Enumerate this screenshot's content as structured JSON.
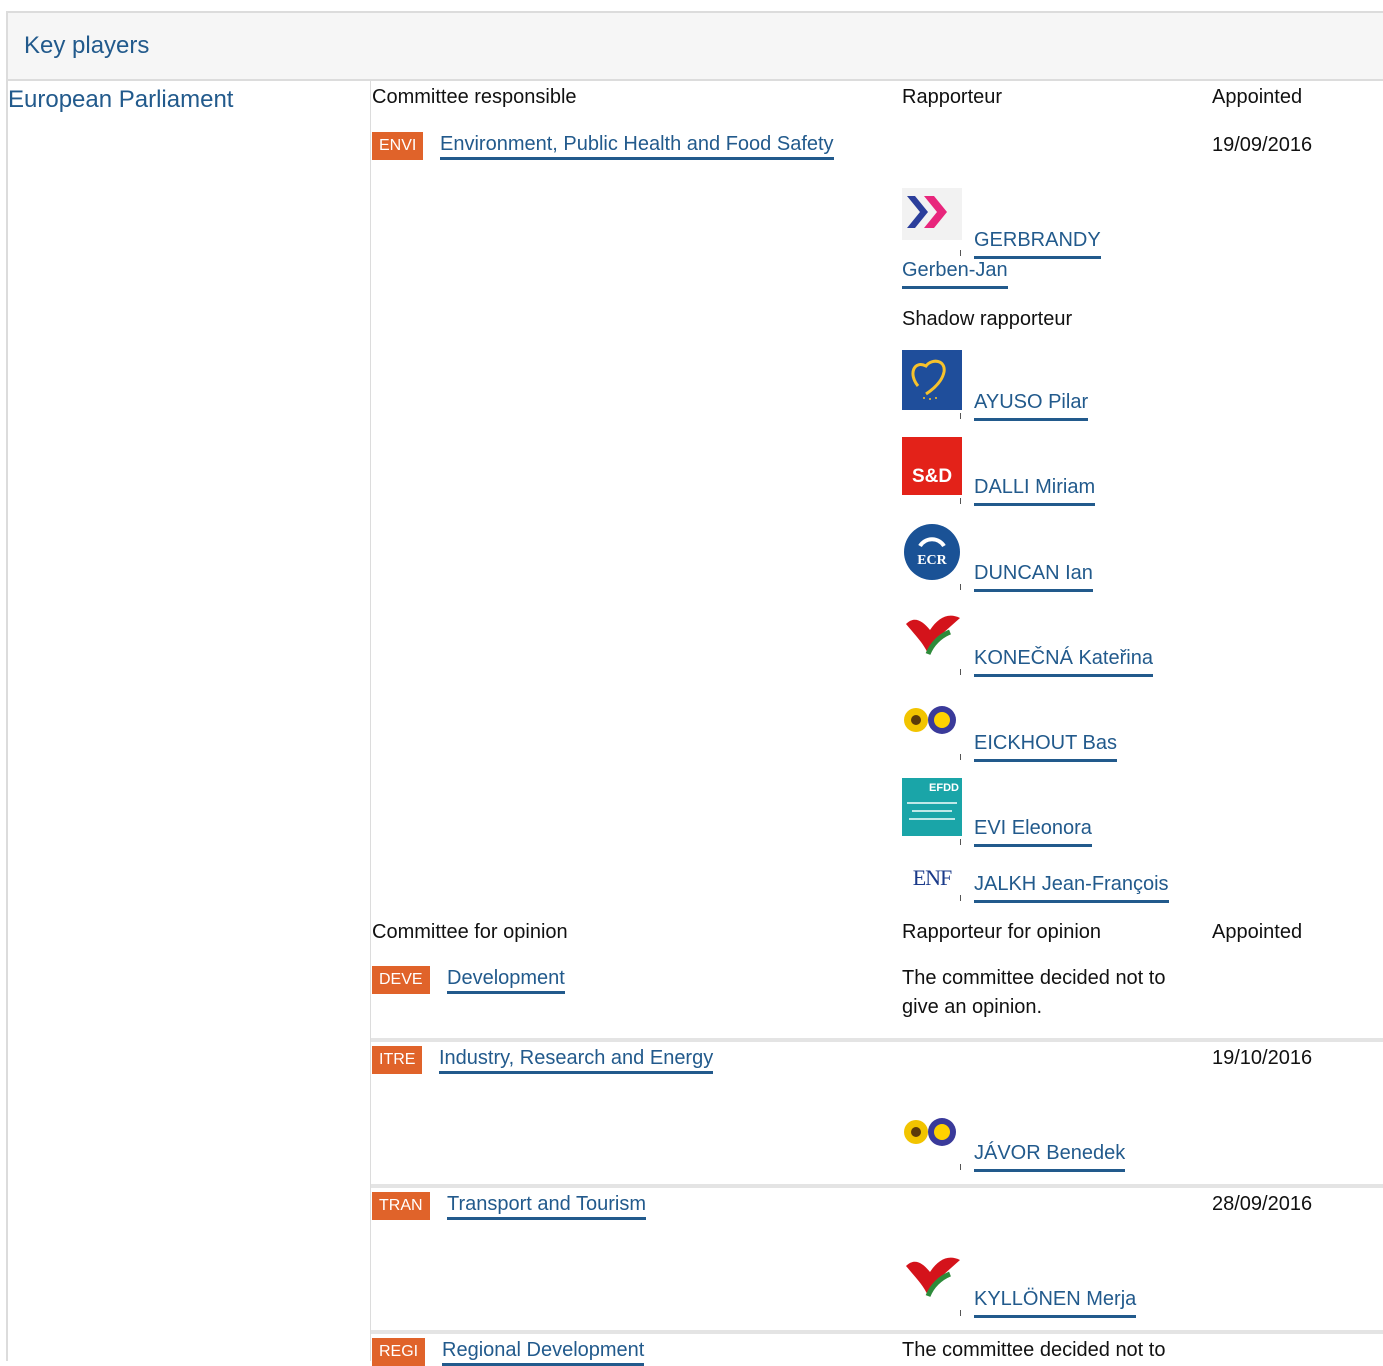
{
  "page_title": "Key players",
  "institution": "European Parliament",
  "committee_responsible": {
    "headers": {
      "committee": "Committee responsible",
      "rapporteur": "Rapporteur",
      "appointed": "Appointed"
    },
    "committee": {
      "code": "ENVI",
      "name": "Environment, Public Health and Food Safety",
      "appointed": "19/09/2016"
    },
    "rapporteur": {
      "name_line1": "GERBRANDY",
      "name_line2": "Gerben-Jan",
      "group_logo": "alde-chevron-logo"
    },
    "shadow_label": "Shadow rapporteur",
    "shadow_rapporteurs": [
      {
        "name": "AYUSO Pilar",
        "group_logo": "epp-heart-logo"
      },
      {
        "name": "DALLI Miriam",
        "group_logo": "sd-logo",
        "logo_text": "S&D"
      },
      {
        "name": "DUNCAN Ian",
        "group_logo": "ecr-logo",
        "logo_text": "ECR"
      },
      {
        "name": "KONEČNÁ Kateřina",
        "group_logo": "gue-ngl-logo"
      },
      {
        "name": "EICKHOUT Bas",
        "group_logo": "greens-efa-logo"
      },
      {
        "name": "EVI Eleonora",
        "group_logo": "efdd-logo",
        "logo_text": "EFDD"
      },
      {
        "name": "JALKH Jean-François",
        "group_logo": "enf-logo",
        "logo_text": "ENF"
      }
    ]
  },
  "committees_for_opinion": {
    "headers": {
      "committee": "Committee for opinion",
      "rapporteur": "Rapporteur for opinion",
      "appointed": "Appointed"
    },
    "rows": [
      {
        "code": "DEVE",
        "name": "Development",
        "note_line1": "The committee decided not to",
        "note_line2": "give an opinion."
      },
      {
        "code": "ITRE",
        "name": "Industry, Research and Energy",
        "appointed": "19/10/2016",
        "rapporteur": "JÁVOR Benedek",
        "group_logo": "greens-efa-logo"
      },
      {
        "code": "TRAN",
        "name": "Transport and Tourism",
        "appointed": "28/09/2016",
        "rapporteur": "KYLLÖNEN Merja",
        "group_logo": "gue-ngl-logo"
      },
      {
        "code": "REGI",
        "name": "Regional Development",
        "note_line1": "The committee decided not to"
      }
    ]
  },
  "colors": {
    "link": "#225a8c",
    "badge": "#e0632a",
    "header_bg": "#f6f6f6",
    "border": "#dcdcdc"
  }
}
